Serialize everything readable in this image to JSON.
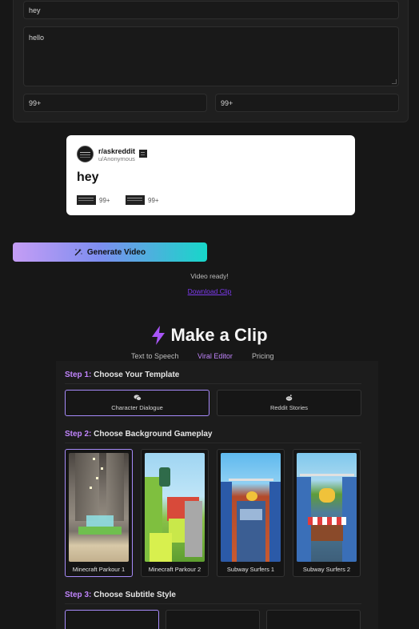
{
  "form": {
    "title_value": "hey",
    "body_value": "hello",
    "upvotes_value": "99+",
    "comments_value": "99+"
  },
  "preview": {
    "subreddit": "r/askreddit",
    "username": "u/Anonymous",
    "title": "hey",
    "upvotes": "99+",
    "comments": "99+"
  },
  "generate": {
    "label": "Generate Video",
    "status": "Video ready!",
    "download_label": "Download Clip"
  },
  "brand": {
    "title": "Make a Clip"
  },
  "nav": [
    {
      "label": "Text to Speech"
    },
    {
      "label": "Viral Editor"
    },
    {
      "label": "Pricing"
    }
  ],
  "steps": [
    {
      "num": "Step 1:",
      "text": "Choose Your Template"
    },
    {
      "num": "Step 2:",
      "text": "Choose Background Gameplay"
    },
    {
      "num": "Step 3:",
      "text": "Choose Subtitle Style"
    }
  ],
  "templates": [
    {
      "label": "Character Dialogue",
      "icon": "chat-icon"
    },
    {
      "label": "Reddit Stories",
      "icon": "reddit-icon"
    }
  ],
  "games": [
    {
      "label": "Minecraft Parkour 1"
    },
    {
      "label": "Minecraft Parkour 2"
    },
    {
      "label": "Subway Surfers 1"
    },
    {
      "label": "Subway Surfers 2"
    }
  ],
  "colors": {
    "accent": "#c084fc",
    "active_nav": "#c084fc",
    "background": "#171717",
    "panel": "#1c1c1c"
  }
}
